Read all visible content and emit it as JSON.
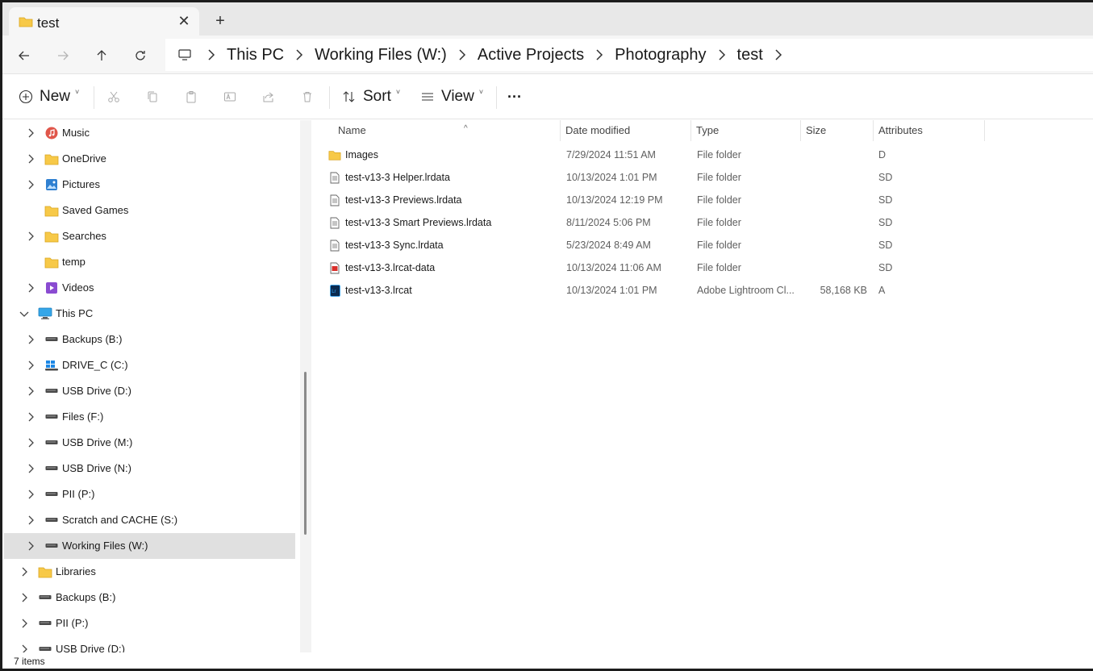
{
  "tab": {
    "title": "test",
    "close": "✕",
    "new": "+"
  },
  "breadcrumb": [
    "This PC",
    "Working Files (W:)",
    "Active Projects",
    "Photography",
    "test"
  ],
  "commands": {
    "new": "New",
    "sort": "Sort",
    "view": "View",
    "more": "···"
  },
  "nav_items": [
    {
      "label": "Music",
      "icon": "music-icon",
      "indent": 1,
      "chevron": true
    },
    {
      "label": "OneDrive",
      "icon": "folder-icon",
      "indent": 1,
      "chevron": true
    },
    {
      "label": "Pictures",
      "icon": "pictures-icon",
      "indent": 1,
      "chevron": true
    },
    {
      "label": "Saved Games",
      "icon": "folder-icon",
      "indent": 1,
      "chevron": false
    },
    {
      "label": "Searches",
      "icon": "folder-icon",
      "indent": 1,
      "chevron": true
    },
    {
      "label": "temp",
      "icon": "folder-icon",
      "indent": 1,
      "chevron": false
    },
    {
      "label": "Videos",
      "icon": "videos-icon",
      "indent": 1,
      "chevron": true
    },
    {
      "label": "This PC",
      "icon": "computer-icon",
      "indent": 0,
      "chevron": true,
      "expanded": true
    },
    {
      "label": "Backups (B:)",
      "icon": "drive-icon",
      "indent": 1,
      "chevron": true
    },
    {
      "label": "DRIVE_C (C:)",
      "icon": "windows-drive-icon",
      "indent": 1,
      "chevron": true
    },
    {
      "label": "USB Drive (D:)",
      "icon": "drive-icon",
      "indent": 1,
      "chevron": true
    },
    {
      "label": "Files (F:)",
      "icon": "drive-icon",
      "indent": 1,
      "chevron": true
    },
    {
      "label": "USB Drive (M:)",
      "icon": "drive-icon",
      "indent": 1,
      "chevron": true
    },
    {
      "label": "USB Drive (N:)",
      "icon": "drive-icon",
      "indent": 1,
      "chevron": true
    },
    {
      "label": "PII (P:)",
      "icon": "drive-icon",
      "indent": 1,
      "chevron": true
    },
    {
      "label": "Scratch and CACHE (S:)",
      "icon": "drive-icon",
      "indent": 1,
      "chevron": true
    },
    {
      "label": "Working Files (W:)",
      "icon": "drive-icon",
      "indent": 1,
      "chevron": true,
      "selected": true
    },
    {
      "label": "Libraries",
      "icon": "folder-icon",
      "indent": 0,
      "chevron": true
    },
    {
      "label": "Backups (B:)",
      "icon": "drive-icon",
      "indent": 0,
      "chevron": true
    },
    {
      "label": "PII (P:)",
      "icon": "drive-icon",
      "indent": 0,
      "chevron": true
    },
    {
      "label": "USB Drive (D:)",
      "icon": "drive-icon",
      "indent": 0,
      "chevron": true
    }
  ],
  "columns": [
    "Name",
    "Date modified",
    "Type",
    "Size",
    "Attributes"
  ],
  "files": [
    {
      "name": "Images",
      "date": "7/29/2024 11:51 AM",
      "type": "File folder",
      "size": "",
      "attr": "D",
      "icon": "folder-icon"
    },
    {
      "name": "test-v13-3 Helper.lrdata",
      "date": "10/13/2024 1:01 PM",
      "type": "File folder",
      "size": "",
      "attr": "SD",
      "icon": "lrdata-icon"
    },
    {
      "name": "test-v13-3 Previews.lrdata",
      "date": "10/13/2024 12:19 PM",
      "type": "File folder",
      "size": "",
      "attr": "SD",
      "icon": "lrdata-icon"
    },
    {
      "name": "test-v13-3 Smart Previews.lrdata",
      "date": "8/11/2024 5:06 PM",
      "type": "File folder",
      "size": "",
      "attr": "SD",
      "icon": "lrdata-icon"
    },
    {
      "name": "test-v13-3 Sync.lrdata",
      "date": "5/23/2024 8:49 AM",
      "type": "File folder",
      "size": "",
      "attr": "SD",
      "icon": "lrdata-icon"
    },
    {
      "name": "test-v13-3.lrcat-data",
      "date": "10/13/2024 11:06 AM",
      "type": "File folder",
      "size": "",
      "attr": "SD",
      "icon": "lrcat-data-icon"
    },
    {
      "name": "test-v13-3.lrcat",
      "date": "10/13/2024 1:01 PM",
      "type": "Adobe Lightroom Cl...",
      "size": "58,168 KB",
      "attr": "A",
      "icon": "lightroom-catalog-icon"
    }
  ],
  "status": {
    "item_count": "7 items"
  },
  "colors": {
    "folder": "#f7c948",
    "selected": "#e0e0e0",
    "tabbar": "#e8e8e8"
  }
}
